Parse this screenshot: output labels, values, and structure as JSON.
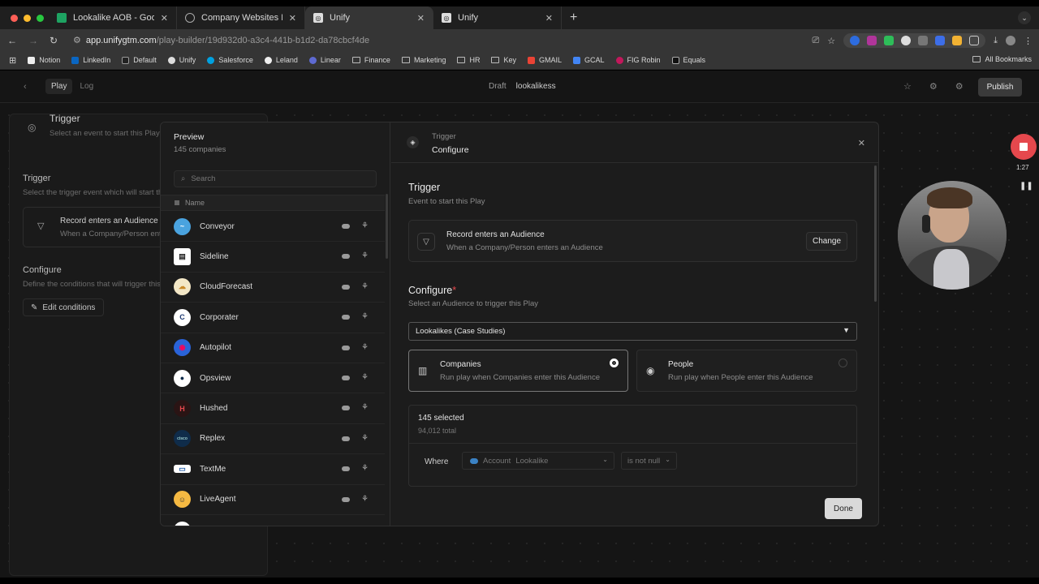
{
  "browser": {
    "tabs": [
      {
        "label": "Lookalike AOB - Google Shee",
        "favicon_color": "#1ea362",
        "active": false
      },
      {
        "label": "Company Websites List",
        "favicon_color": "#888888",
        "active": false
      },
      {
        "label": "Unify",
        "favicon_color": "#dddddd",
        "active": true
      },
      {
        "label": "Unify",
        "favicon_color": "#dddddd",
        "active": false
      }
    ],
    "url_host": "app.unifygtm.com",
    "url_path": "/play-builder/19d932d0-a3c4-441b-b1d2-da78cbcf4de",
    "bookmarks": [
      {
        "label": "Notion",
        "icon": "notion-icon"
      },
      {
        "label": "LinkedIn",
        "icon": "linkedin-icon"
      },
      {
        "label": "Default",
        "icon": "default-icon"
      },
      {
        "label": "Unify",
        "icon": "unify-icon"
      },
      {
        "label": "Salesforce",
        "icon": "salesforce-icon"
      },
      {
        "label": "Leland",
        "icon": "leland-icon"
      },
      {
        "label": "Linear",
        "icon": "linear-icon"
      },
      {
        "label": "Finance",
        "icon": "folder-icon"
      },
      {
        "label": "Marketing",
        "icon": "folder-icon"
      },
      {
        "label": "HR",
        "icon": "folder-icon"
      },
      {
        "label": "Key",
        "icon": "folder-icon"
      },
      {
        "label": "GMAIL",
        "icon": "gmail-icon"
      },
      {
        "label": "GCAL",
        "icon": "gcal-icon"
      },
      {
        "label": "FIG Robin",
        "icon": "fig-icon"
      },
      {
        "label": "Equals",
        "icon": "equals-icon"
      }
    ],
    "all_bookmarks": "All Bookmarks"
  },
  "app": {
    "tabs": {
      "play": "Play",
      "log": "Log"
    },
    "status": "Draft",
    "play_name": "lookalikess",
    "publish": "Publish"
  },
  "sidepanel": {
    "trigger_title": "Trigger",
    "trigger_sub": "Select an event to start this Play",
    "trigger_label": "Trigger",
    "trigger_desc": "Select the trigger event which will start th",
    "card_title": "Record enters an Audience",
    "card_sub": "When a Company/Person ente",
    "configure_label": "Configure",
    "configure_desc": "Define the conditions that will trigger this",
    "edit_conditions": "Edit conditions"
  },
  "preview": {
    "title": "Preview",
    "count": "145 companies",
    "search_placeholder": "Search",
    "column_name": "Name",
    "companies": [
      {
        "name": "Conveyor",
        "logo_bg": "#4aa3df",
        "logo_text": "~"
      },
      {
        "name": "Sideline",
        "logo_bg": "#ffffff",
        "logo_text": "▤"
      },
      {
        "name": "CloudForecast",
        "logo_bg": "#f3e7c6",
        "logo_text": "☁"
      },
      {
        "name": "Corporater",
        "logo_bg": "#ffffff",
        "logo_text": "C"
      },
      {
        "name": "Autopilot",
        "logo_bg": "#2a63d8",
        "logo_text": "◉"
      },
      {
        "name": "Opsview",
        "logo_bg": "#ffffff",
        "logo_text": "●"
      },
      {
        "name": "Hushed",
        "logo_bg": "#2a1414",
        "logo_text": "H"
      },
      {
        "name": "Replex",
        "logo_bg": "#0f2c4a",
        "logo_text": "cisco"
      },
      {
        "name": "TextMe",
        "logo_bg": "#ffffff",
        "logo_text": "▭"
      },
      {
        "name": "LiveAgent",
        "logo_bg": "#f5b942",
        "logo_text": "☺"
      }
    ]
  },
  "config": {
    "header_kicker": "Trigger",
    "header_title": "Configure",
    "trigger_title": "Trigger",
    "trigger_sub": "Event to start this Play",
    "trigger_card_title": "Record enters an Audience",
    "trigger_card_sub": "When a Company/Person enters an Audience",
    "change": "Change",
    "configure_title": "Configure",
    "configure_sub": "Select an Audience to trigger this Play",
    "audience_selected": "Lookalikes (Case Studies)",
    "option_companies_title": "Companies",
    "option_companies_sub": "Run play when Companies enter this Audience",
    "option_people_title": "People",
    "option_people_sub": "Run play when People enter this Audience",
    "selected_count": "145 selected",
    "total_count": "94,012 total",
    "where": "Where",
    "condition_field_prefix": "Account",
    "condition_field": "Lookalike",
    "condition_operator": "is not null",
    "done": "Done"
  },
  "recorder": {
    "time": "1:27",
    "stop_color": "#e5484d"
  }
}
